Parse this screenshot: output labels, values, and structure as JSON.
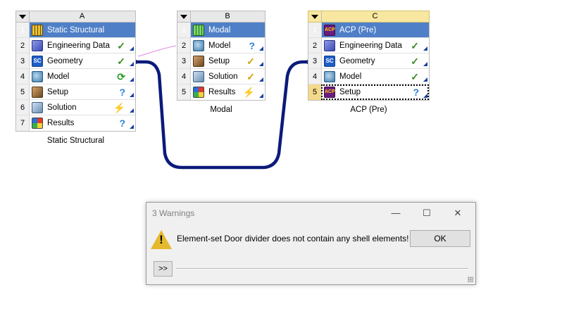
{
  "systems": [
    {
      "letter": "A",
      "caption": "Static Structural",
      "rows": [
        {
          "num": "1",
          "label": "Static Structural",
          "icon": "structural-icon",
          "status": ""
        },
        {
          "num": "2",
          "label": "Engineering Data",
          "icon": "book-icon",
          "status": "✓"
        },
        {
          "num": "3",
          "label": "Geometry",
          "icon": "spaceclaim-icon",
          "icon_text": "SC",
          "status": "✓"
        },
        {
          "num": "4",
          "label": "Model",
          "icon": "model-icon",
          "status": "⟳"
        },
        {
          "num": "5",
          "label": "Setup",
          "icon": "setup-icon",
          "status": "?"
        },
        {
          "num": "6",
          "label": "Solution",
          "icon": "solution-icon",
          "status": "⚡"
        },
        {
          "num": "7",
          "label": "Results",
          "icon": "results-icon",
          "status": "?"
        }
      ]
    },
    {
      "letter": "B",
      "caption": "Modal",
      "rows": [
        {
          "num": "1",
          "label": "Modal",
          "icon": "modal-icon",
          "status": ""
        },
        {
          "num": "2",
          "label": "Model",
          "icon": "model-icon",
          "status": "?"
        },
        {
          "num": "3",
          "label": "Setup",
          "icon": "setup-icon",
          "status": "✓"
        },
        {
          "num": "4",
          "label": "Solution",
          "icon": "solution-icon",
          "status": "✓"
        },
        {
          "num": "5",
          "label": "Results",
          "icon": "results-icon",
          "status": "⚡"
        }
      ]
    },
    {
      "letter": "C",
      "caption": "ACP (Pre)",
      "rows": [
        {
          "num": "1",
          "label": "ACP (Pre)",
          "icon": "acp-icon",
          "icon_text": "ACP",
          "status": ""
        },
        {
          "num": "2",
          "label": "Engineering Data",
          "icon": "book-icon",
          "status": "✓"
        },
        {
          "num": "3",
          "label": "Geometry",
          "icon": "spaceclaim-icon",
          "icon_text": "SC",
          "status": "✓"
        },
        {
          "num": "4",
          "label": "Model",
          "icon": "model-icon",
          "status": "✓"
        },
        {
          "num": "5",
          "label": "Setup",
          "icon": "acp-icon",
          "icon_text": "ACP",
          "status": "?"
        }
      ]
    }
  ],
  "dialog": {
    "title": "3 Warnings",
    "minimize": "—",
    "maximize": "☐",
    "close": "✕",
    "message": "Element-set Door divider does not contain any shell elements!",
    "ok_label": "OK",
    "expand_label": ">>",
    "warning_mark": "!"
  },
  "colors": {
    "title_row": "#4f7fc7",
    "selected_header": "#f7e7a0",
    "link_line": "#0b1a7a",
    "modal_link": "#e6a0e6"
  }
}
